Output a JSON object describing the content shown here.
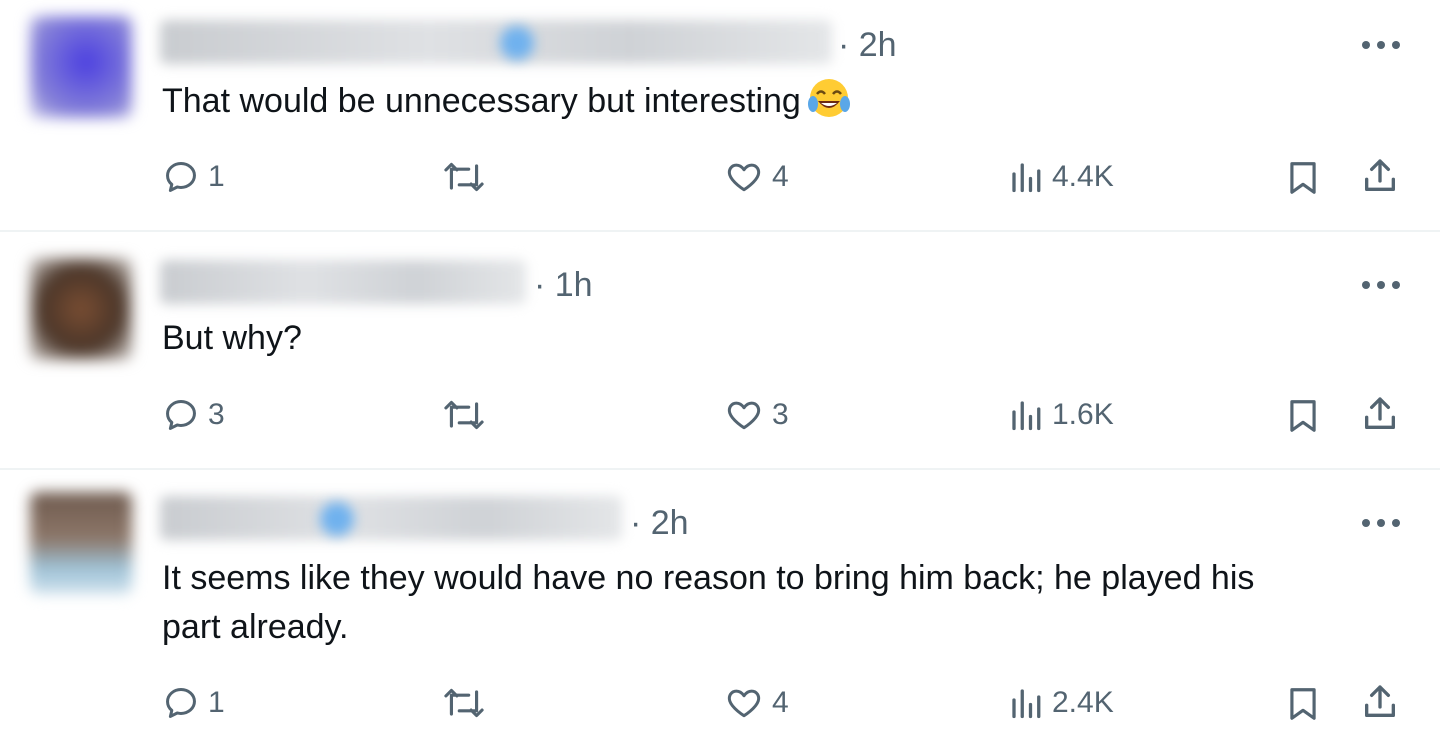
{
  "posts": [
    {
      "time": "· 2h",
      "text": "That would be unnecessary but interesting",
      "emoji": "face-with-tears-of-joy",
      "replies": "1",
      "likes": "4",
      "views": "4.4K",
      "avatar_color": "#6a5fd8"
    },
    {
      "time": "· 1h",
      "text": "But why?",
      "replies": "3",
      "likes": "3",
      "views": "1.6K",
      "avatar_color": "#6b4a35"
    },
    {
      "time": "· 2h",
      "text_line1": "It seems like they would have no reason to bring him back; he played his",
      "text_line2": "part already.",
      "replies": "1",
      "likes": "4",
      "views": "2.4K",
      "avatar_color": "#7a6a60"
    }
  ],
  "icons": {
    "reply": "reply-icon",
    "retweet": "retweet-icon",
    "like": "heart-icon",
    "views": "views-bar-chart-icon",
    "bookmark": "bookmark-icon",
    "share": "share-icon",
    "more": "more-icon"
  },
  "colors": {
    "icon_gray": "#536471",
    "text": "#0f1419",
    "divider": "#eff3f4",
    "verified_blue": "#1d9bf0"
  }
}
